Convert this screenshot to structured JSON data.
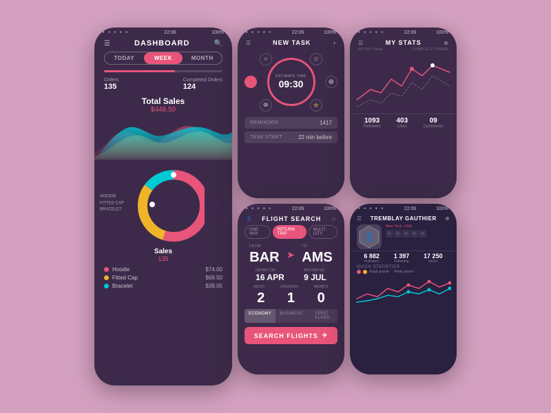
{
  "background": "#d4a0c0",
  "dashboard": {
    "status_time": "22:06",
    "status_battery": "100%",
    "title": "DASHBOARD",
    "tab_today": "TODAY",
    "tab_week": "WEEK",
    "tab_month": "MONTH",
    "orders_label": "Orders",
    "orders_value": "135",
    "completed_label": "Completed Orders",
    "completed_value": "124",
    "total_sales_label": "Total Sales",
    "total_sales_value": "$448.50",
    "donut_label1": "HOODIE",
    "donut_label2": "FITTED CAP",
    "donut_label3": "BRACELET",
    "sales_label": "Sales",
    "sales_value": "135",
    "legend": [
      {
        "name": "Hoodie",
        "price": "$74.00",
        "color": "#e8547a"
      },
      {
        "name": "Fitted Cap",
        "price": "$69.50",
        "color": "#f0b429"
      },
      {
        "name": "Bracelet",
        "price": "$39.05",
        "color": "#00c9d4"
      }
    ]
  },
  "new_task": {
    "status_time": "22:06",
    "title": "NEW TASK",
    "estimate_label": "ESTIMATE TIME",
    "time": "09:30",
    "reminder_label": "REMINDER",
    "reminder_value": "1417",
    "task_start_label": "TASK START",
    "task_start_value": "22 min before"
  },
  "my_stats": {
    "status_time": "22:06",
    "title": "MY STATS",
    "subtitle": "COMPLETE TREND",
    "views": "60.054 Views",
    "followers": "1093",
    "followers_label": "Followers",
    "likes": "403",
    "likes_label": "Likes",
    "comments": "09",
    "comments_label": "Comments"
  },
  "flight_search": {
    "status_time": "22:06",
    "title": "FLIGHT SEARCH",
    "tab_oneway": "ONE WAY",
    "tab_return": "RETURN TRIP",
    "tab_multi": "MULTI CITY",
    "from_label": "FROM",
    "from_code": "BAR",
    "to_label": "TO",
    "to_code": "AMS",
    "depart_label": "DEPART ON",
    "depart_value": "16 APR",
    "return_label": "RETURN ON",
    "return_value": "9 JUL",
    "adult_label": "ADULT",
    "children_label": "CHILDREN",
    "infants_label": "INFANTS",
    "adult_num": "2",
    "children_num": "1",
    "infants_num": "0",
    "class_economy": "ECONOMY",
    "class_business": "BUSINESS",
    "class_first": "FIRST CLASS",
    "search_label": "SEARCH FLIGHTS"
  },
  "profile": {
    "status_time": "22:06",
    "title": "TREMBLAY GAUTHIER",
    "location": "New York, USA",
    "followers_value": "6 882",
    "followers_label": "Followers",
    "following_value": "1 397",
    "following_label": "Following",
    "notes_value": "17 250",
    "notes_label": "Notes",
    "quick_stats_label": "QUICK STATISTICS",
    "user1": "Anjali grande",
    "user2": "Wells gabriel"
  }
}
